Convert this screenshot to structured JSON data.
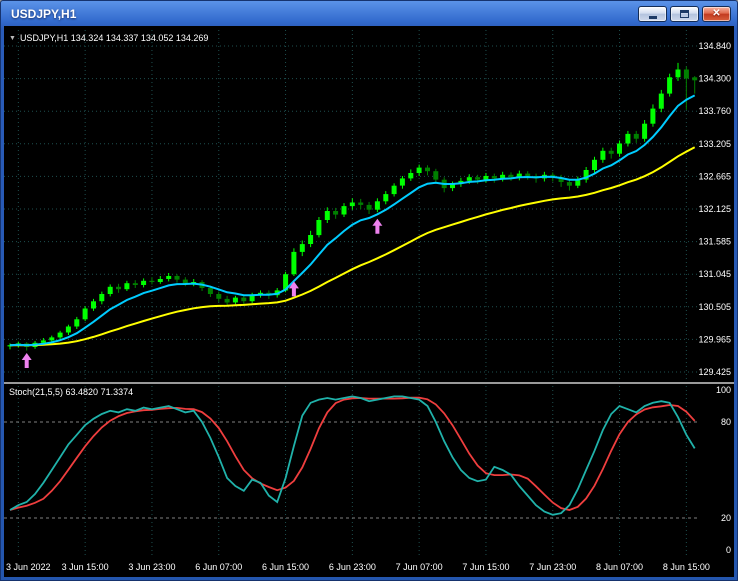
{
  "window": {
    "title": "USDJPY,H1"
  },
  "chart": {
    "dropdown_marker": "▼",
    "ohlc_text": "USDJPY,H1 134.324 134.337 134.052 134.269",
    "indicator_label": "Stoch(21,5,5) 63.4820 71.3374"
  },
  "chart_data": {
    "type": "candlestick",
    "symbol": "USDJPY",
    "timeframe": "H1",
    "title": "USDJPY,H1",
    "price_axis": {
      "labels": [
        "134.840",
        "134.300",
        "133.760",
        "133.205",
        "132.665",
        "132.125",
        "131.585",
        "131.045",
        "130.505",
        "129.965",
        "129.425"
      ],
      "max": 134.84,
      "min": 129.425
    },
    "time_axis": {
      "labels": [
        "3 Jun 2022",
        "3 Jun 15:00",
        "3 Jun 23:00",
        "6 Jun 07:00",
        "6 Jun 15:00",
        "6 Jun 23:00",
        "7 Jun 07:00",
        "7 Jun 15:00",
        "7 Jun 23:00",
        "8 Jun 07:00",
        "8 Jun 15:00"
      ]
    },
    "stoch_axis": {
      "labels": [
        "100",
        "80",
        "20",
        "0"
      ],
      "values": [
        100,
        80,
        20,
        0
      ],
      "levels": [
        80,
        20
      ]
    },
    "bars": [
      [
        129.85,
        129.9,
        129.8,
        129.87
      ],
      [
        129.87,
        129.93,
        129.83,
        129.9
      ],
      [
        129.9,
        129.92,
        129.78,
        129.84
      ],
      [
        129.84,
        129.94,
        129.81,
        129.91
      ],
      [
        129.91,
        129.99,
        129.88,
        129.95
      ],
      [
        129.95,
        130.03,
        129.91,
        130.0
      ],
      [
        130.0,
        130.11,
        129.97,
        130.08
      ],
      [
        130.08,
        130.21,
        130.04,
        130.18
      ],
      [
        130.18,
        130.34,
        130.14,
        130.3
      ],
      [
        130.3,
        130.52,
        130.27,
        130.48
      ],
      [
        130.48,
        130.64,
        130.44,
        130.6
      ],
      [
        130.6,
        130.76,
        130.55,
        130.72
      ],
      [
        130.72,
        130.88,
        130.68,
        130.84
      ],
      [
        130.84,
        130.89,
        130.74,
        130.8
      ],
      [
        130.8,
        130.94,
        130.77,
        130.9
      ],
      [
        130.9,
        130.95,
        130.82,
        130.87
      ],
      [
        130.87,
        130.98,
        130.83,
        130.94
      ],
      [
        130.94,
        131.0,
        130.88,
        130.92
      ],
      [
        130.92,
        131.02,
        130.89,
        130.97
      ],
      [
        130.97,
        131.07,
        130.93,
        131.02
      ],
      [
        131.02,
        131.05,
        130.91,
        130.96
      ],
      [
        130.96,
        131.0,
        130.85,
        130.89
      ],
      [
        130.89,
        130.97,
        130.85,
        130.92
      ],
      [
        130.92,
        130.95,
        130.77,
        130.82
      ],
      [
        130.82,
        130.86,
        130.67,
        130.72
      ],
      [
        130.72,
        130.76,
        130.59,
        130.64
      ],
      [
        130.64,
        130.69,
        130.53,
        130.58
      ],
      [
        130.58,
        130.69,
        130.55,
        130.66
      ],
      [
        130.66,
        130.7,
        130.55,
        130.6
      ],
      [
        130.6,
        130.74,
        130.57,
        130.7
      ],
      [
        130.7,
        130.78,
        130.66,
        130.74
      ],
      [
        130.74,
        130.78,
        130.64,
        130.7
      ],
      [
        130.7,
        130.82,
        130.66,
        130.78
      ],
      [
        130.78,
        131.09,
        130.75,
        131.05
      ],
      [
        131.05,
        131.48,
        131.02,
        131.42
      ],
      [
        131.42,
        131.61,
        131.35,
        131.55
      ],
      [
        131.55,
        131.77,
        131.5,
        131.7
      ],
      [
        131.7,
        132.0,
        131.66,
        131.95
      ],
      [
        131.95,
        132.16,
        131.9,
        132.1
      ],
      [
        132.1,
        132.15,
        131.97,
        132.04
      ],
      [
        132.04,
        132.23,
        132.0,
        132.18
      ],
      [
        132.18,
        132.31,
        132.12,
        132.24
      ],
      [
        132.24,
        132.3,
        132.13,
        132.2
      ],
      [
        132.2,
        132.25,
        132.05,
        132.12
      ],
      [
        132.12,
        132.31,
        132.08,
        132.26
      ],
      [
        132.26,
        132.43,
        132.21,
        132.38
      ],
      [
        132.38,
        132.56,
        132.34,
        132.52
      ],
      [
        132.52,
        132.68,
        132.47,
        132.64
      ],
      [
        132.64,
        132.79,
        132.6,
        132.73
      ],
      [
        132.73,
        132.87,
        132.68,
        132.82
      ],
      [
        132.82,
        132.86,
        132.69,
        132.76
      ],
      [
        132.76,
        132.8,
        132.57,
        132.62
      ],
      [
        132.62,
        132.66,
        132.41,
        132.48
      ],
      [
        132.48,
        132.59,
        132.43,
        132.55
      ],
      [
        132.55,
        132.65,
        132.5,
        132.6
      ],
      [
        132.6,
        132.71,
        132.55,
        132.66
      ],
      [
        132.66,
        132.7,
        132.55,
        132.62
      ],
      [
        132.62,
        132.73,
        132.57,
        132.68
      ],
      [
        132.68,
        132.72,
        132.57,
        132.64
      ],
      [
        132.64,
        132.75,
        132.59,
        132.7
      ],
      [
        132.7,
        132.74,
        132.6,
        132.66
      ],
      [
        132.66,
        132.77,
        132.61,
        132.72
      ],
      [
        132.72,
        132.76,
        132.62,
        132.68
      ],
      [
        132.68,
        132.72,
        132.57,
        132.64
      ],
      [
        132.64,
        132.75,
        132.59,
        132.7
      ],
      [
        132.7,
        132.74,
        132.59,
        132.66
      ],
      [
        132.66,
        132.7,
        132.5,
        132.58
      ],
      [
        132.58,
        132.63,
        132.44,
        132.52
      ],
      [
        132.52,
        132.67,
        132.48,
        132.62
      ],
      [
        132.62,
        132.83,
        132.57,
        132.78
      ],
      [
        132.78,
        133.0,
        132.73,
        132.95
      ],
      [
        132.95,
        133.15,
        132.9,
        133.1
      ],
      [
        133.1,
        133.15,
        132.97,
        133.05
      ],
      [
        133.05,
        133.27,
        133.0,
        133.22
      ],
      [
        133.22,
        133.43,
        133.17,
        133.38
      ],
      [
        133.38,
        133.43,
        133.23,
        133.3
      ],
      [
        133.3,
        133.61,
        133.25,
        133.55
      ],
      [
        133.55,
        133.87,
        133.5,
        133.8
      ],
      [
        133.8,
        134.11,
        133.74,
        134.05
      ],
      [
        134.05,
        134.38,
        134.0,
        134.32
      ],
      [
        134.32,
        134.56,
        134.26,
        134.45
      ],
      [
        134.45,
        134.5,
        133.78,
        134.3
      ],
      [
        134.32,
        134.34,
        134.05,
        134.27
      ]
    ],
    "overlays": [
      {
        "name": "ma-fast-line",
        "period": 8,
        "color": "#00CCFF"
      },
      {
        "name": "ma-slow-line",
        "period": 32,
        "color": "#FFFF00"
      }
    ],
    "stochastic": {
      "label": "Stoch(21,5,5)",
      "last_main": 63.482,
      "last_signal": 71.3374,
      "signal_period": 5,
      "main": [
        25,
        28,
        30,
        35,
        42,
        50,
        58,
        66,
        72,
        78,
        82,
        85,
        87,
        86,
        88,
        87,
        89,
        88,
        89,
        90,
        88,
        86,
        87,
        80,
        70,
        58,
        45,
        40,
        37,
        44,
        42,
        34,
        30,
        45,
        65,
        84,
        92,
        94,
        95,
        94,
        95,
        96,
        95,
        93,
        94,
        95,
        96,
        96,
        95,
        94,
        90,
        80,
        68,
        58,
        50,
        45,
        43,
        44,
        52,
        50,
        47,
        40,
        34,
        28,
        24,
        22,
        23,
        28,
        38,
        50,
        62,
        75,
        85,
        90,
        88,
        86,
        90,
        92,
        93,
        92,
        83,
        72,
        63.5
      ]
    },
    "arrows": [
      {
        "bar": 2,
        "price": 129.74
      },
      {
        "bar": 34,
        "price": 130.93
      },
      {
        "bar": 44,
        "price": 131.97
      }
    ],
    "colors": {
      "background": "#000000",
      "grid": "#1e4f4f",
      "bull": "#00FF00",
      "bear": "#008000",
      "ma_fast": "#00CCFF",
      "ma_slow": "#FFFF00",
      "stoch_main": "#20B2AA",
      "stoch_signal": "#EF3E3E",
      "arrow": "#EE82EE",
      "axis_text": "#FFFFFF",
      "level": "#808080",
      "separator": "#9A9A9A"
    }
  }
}
